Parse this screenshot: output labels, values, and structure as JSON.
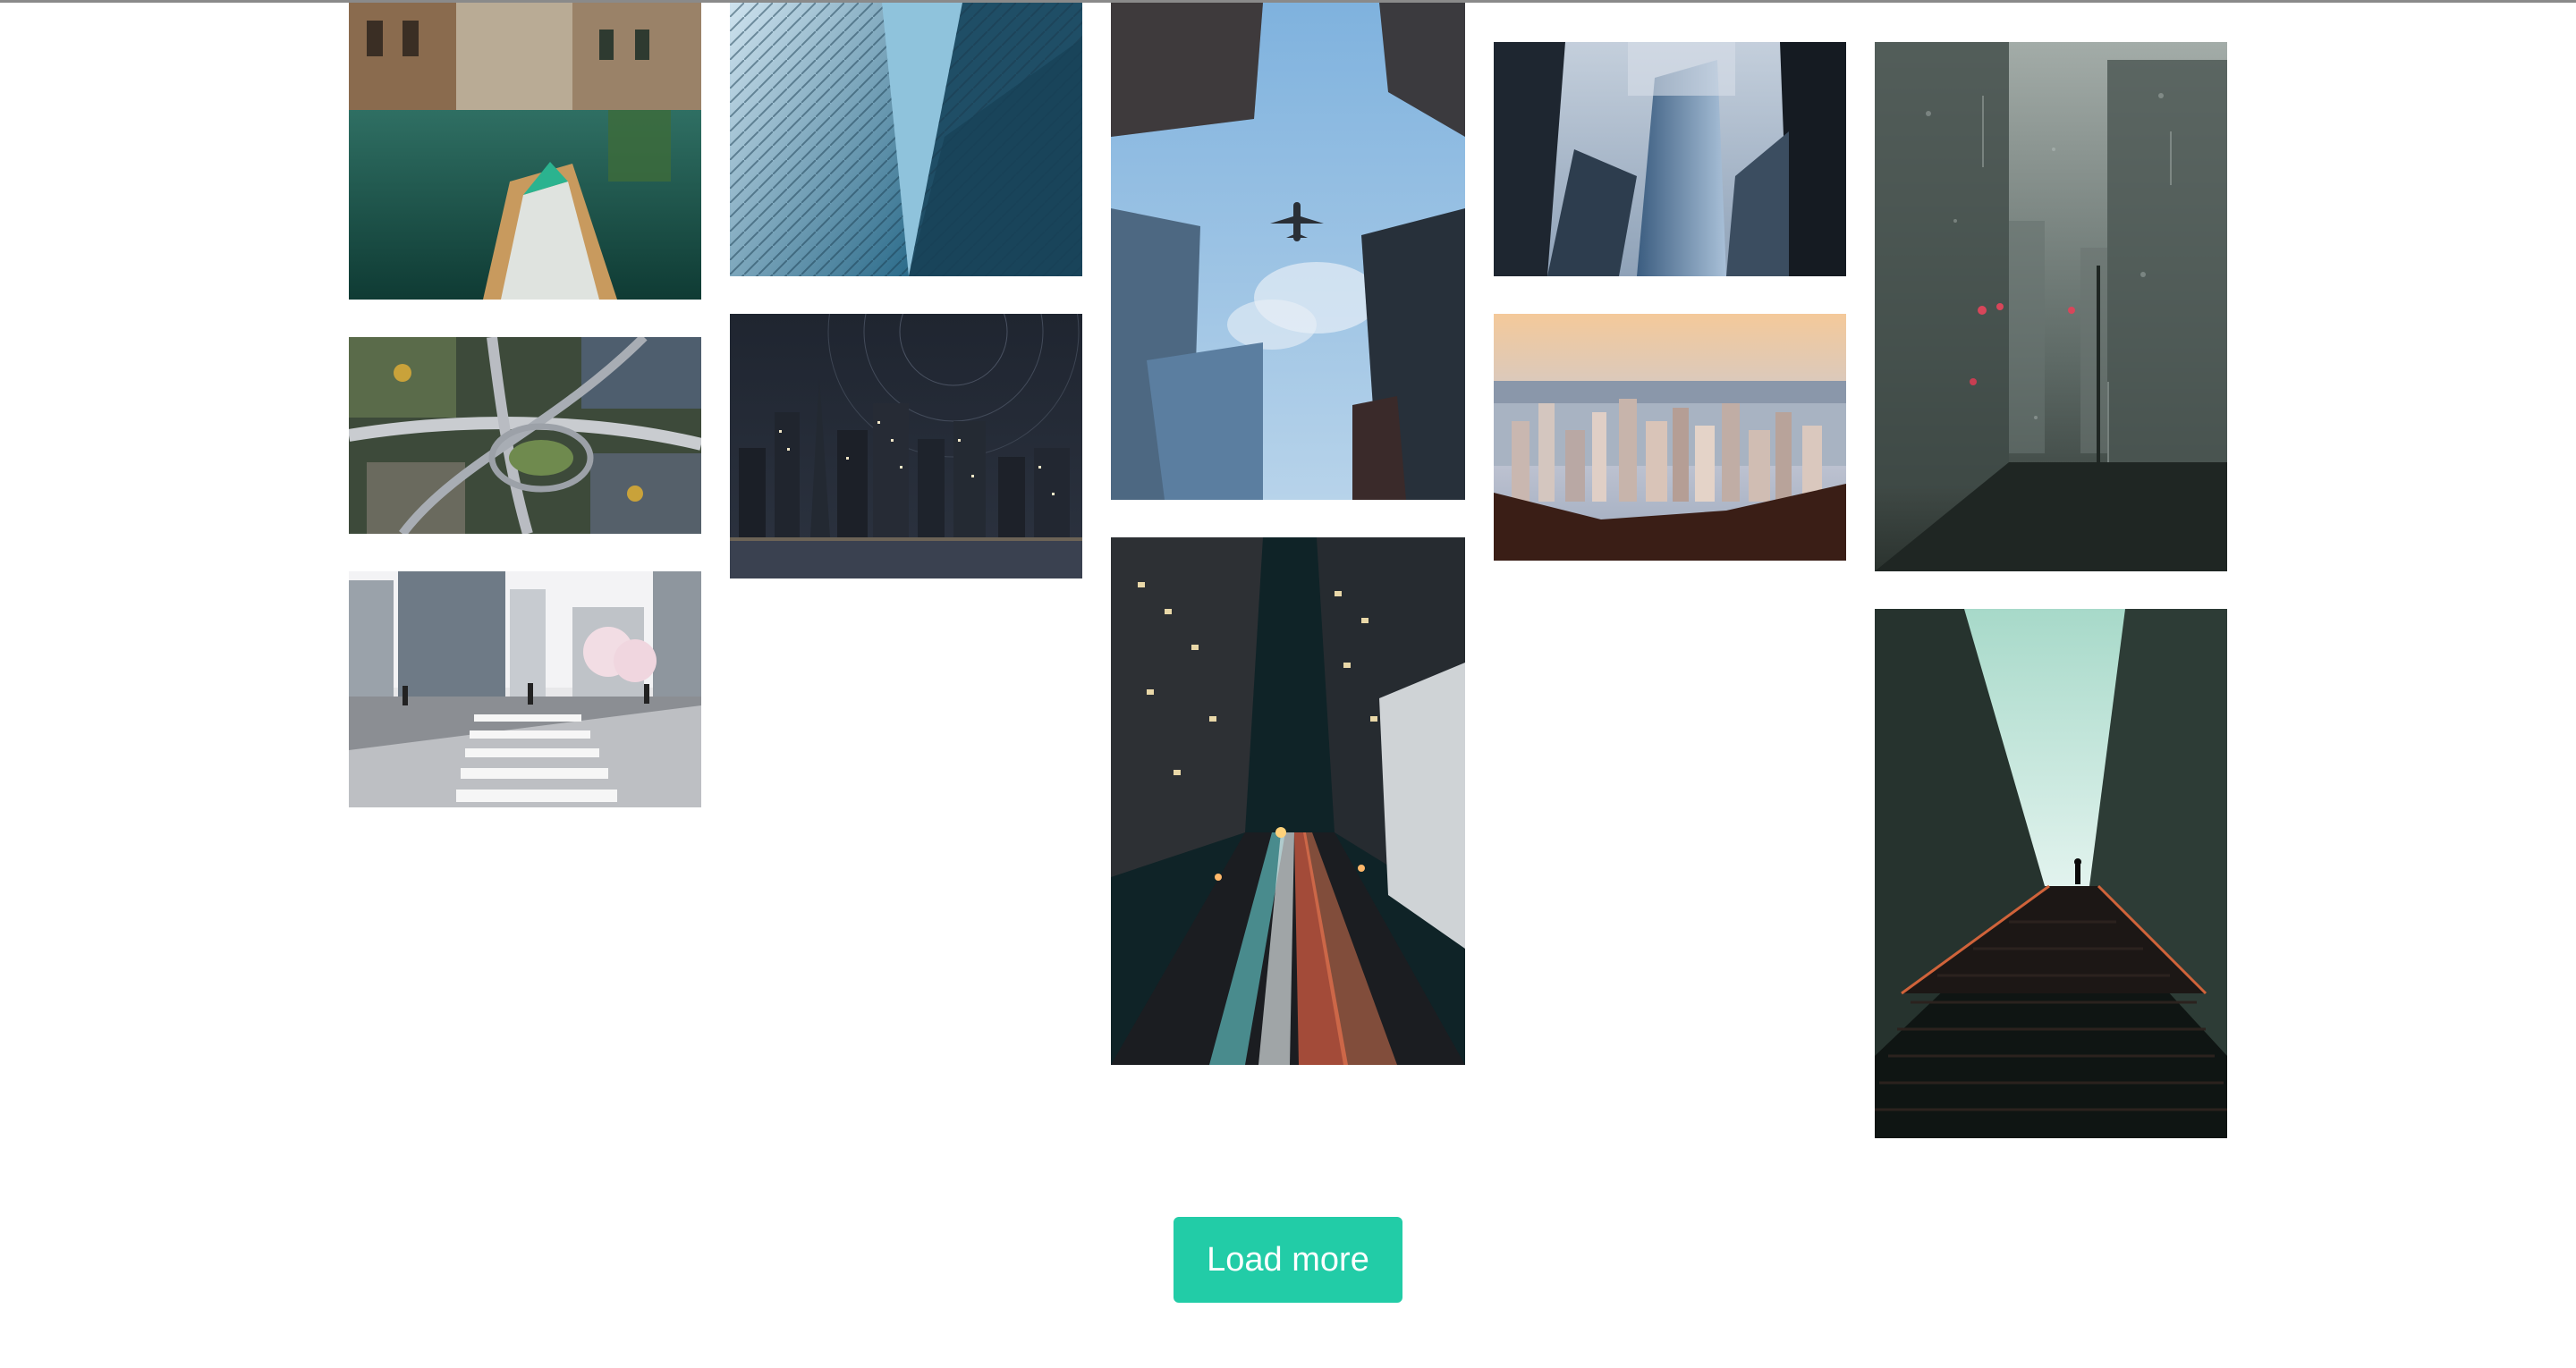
{
  "gallery": {
    "photos": [
      {
        "subject": "venice-canal-boat"
      },
      {
        "subject": "aerial-highway-interchange"
      },
      {
        "subject": "city-crosswalk"
      },
      {
        "subject": "glass-skyscraper-facade"
      },
      {
        "subject": "night-skyline-star-trails"
      },
      {
        "subject": "airplane-between-skyscrapers"
      },
      {
        "subject": "night-street-light-trails"
      },
      {
        "subject": "skyscraper-in-fog"
      },
      {
        "subject": "harbour-city-sunset"
      },
      {
        "subject": "rainy-window-street"
      },
      {
        "subject": "stairway-to-light"
      }
    ]
  },
  "actions": {
    "load_more_label": "Load more"
  },
  "colors": {
    "accent": "#22cca7",
    "background": "#ffffff"
  }
}
